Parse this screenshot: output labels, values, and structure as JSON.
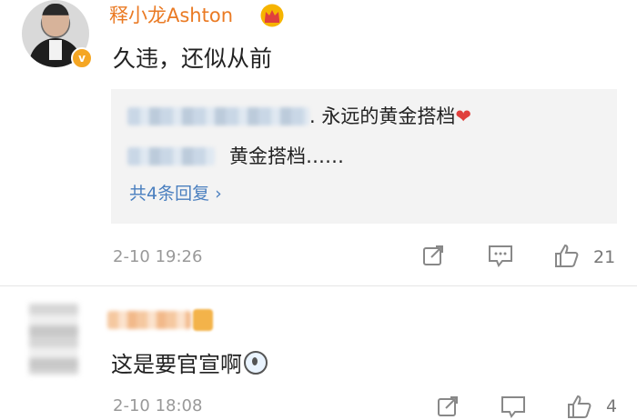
{
  "comments": [
    {
      "username": "释小龙Ashton",
      "text": "久违，还似从前",
      "replies": [
        {
          "name_visible": ". 永远的黄金搭档",
          "heart": "❤"
        },
        {
          "text": "黄金搭档……"
        }
      ],
      "more_replies": "共4条回复 ›",
      "time": "2-10 19:26",
      "likes": "21"
    },
    {
      "text": "这是要官宣啊",
      "time": "2-10 18:08",
      "likes": "4"
    }
  ],
  "colors": {
    "username": "#ea7a23",
    "link": "#4a7fbf",
    "meta": "#999999",
    "heart": "#e0403d"
  },
  "icons": [
    "crown-icon",
    "verified-icon",
    "share-icon",
    "comment-icon",
    "like-icon"
  ]
}
